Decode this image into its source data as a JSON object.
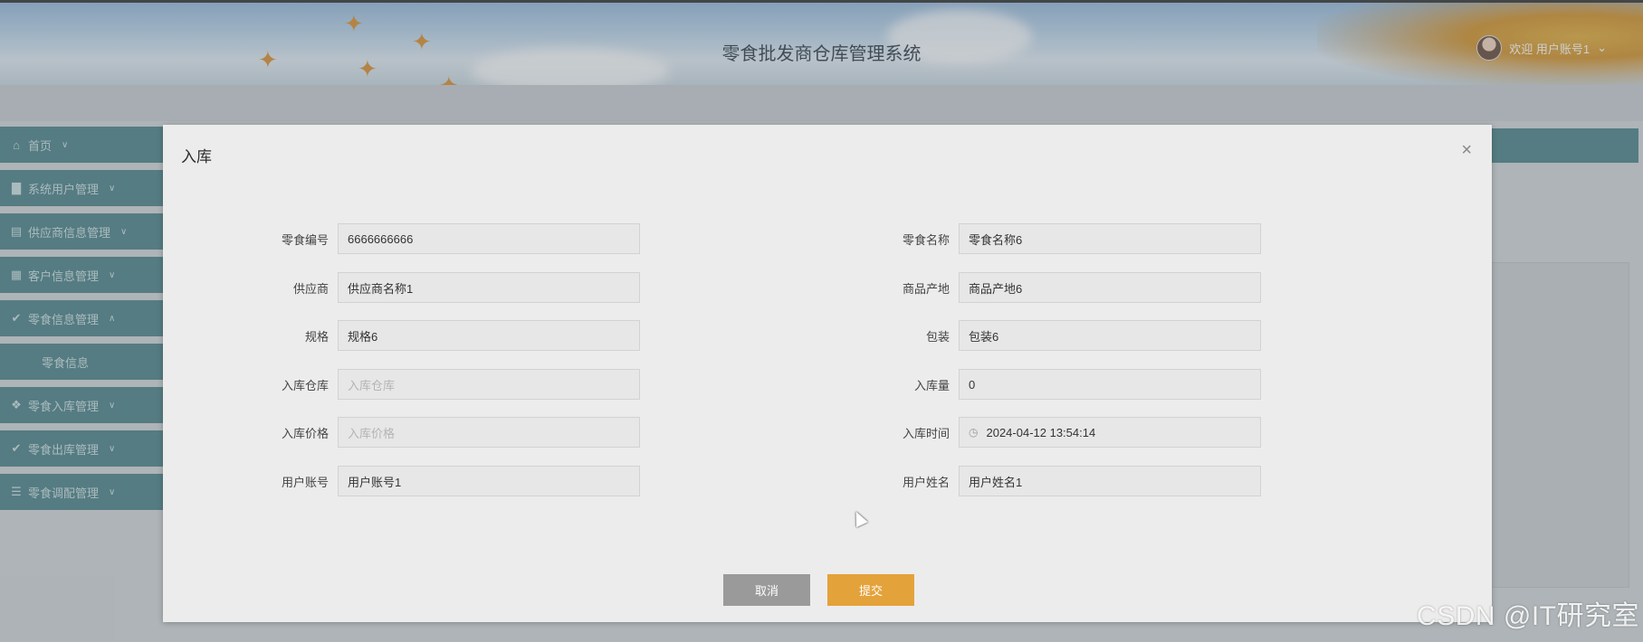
{
  "header": {
    "app_title": "零食批发商仓库管理系统",
    "user_greeting": "欢迎 用户账号1"
  },
  "sidebar": {
    "items": [
      {
        "label": "首页",
        "icon": "home-icon"
      },
      {
        "label": "系统用户管理",
        "icon": "user-icon"
      },
      {
        "label": "供应商信息管理",
        "icon": "folder-icon"
      },
      {
        "label": "客户信息管理",
        "icon": "grid-icon"
      },
      {
        "label": "零食信息管理",
        "icon": "check-circle-icon"
      },
      {
        "label": "零食入库管理",
        "icon": "apps-icon"
      },
      {
        "label": "零食出库管理",
        "icon": "check-circle-icon"
      },
      {
        "label": "零食调配管理",
        "icon": "list-icon"
      }
    ],
    "sub_item": "零食信息"
  },
  "dialog": {
    "title": "入库",
    "fields": {
      "snack_code": {
        "label": "零食编号",
        "value": "6666666666"
      },
      "snack_name": {
        "label": "零食名称",
        "value": "零食名称6"
      },
      "supplier": {
        "label": "供应商",
        "value": "供应商名称1"
      },
      "origin": {
        "label": "商品产地",
        "value": "商品产地6"
      },
      "spec": {
        "label": "规格",
        "value": "规格6"
      },
      "package": {
        "label": "包装",
        "value": "包装6"
      },
      "warehouse": {
        "label": "入库仓库",
        "placeholder": "入库仓库"
      },
      "quantity": {
        "label": "入库量",
        "value": "0"
      },
      "price": {
        "label": "入库价格",
        "placeholder": "入库价格"
      },
      "time": {
        "label": "入库时间",
        "value": "2024-04-12 13:54:14"
      },
      "account": {
        "label": "用户账号",
        "value": "用户账号1"
      },
      "user_name": {
        "label": "用户姓名",
        "value": "用户姓名1"
      }
    },
    "buttons": {
      "cancel": "取消",
      "submit": "提交"
    },
    "close": "×"
  },
  "watermark": "CSDN @IT研究室",
  "colors": {
    "sidebar": "#3f7a80",
    "submit": "#e4a23a",
    "cancel": "#9a9a9a"
  }
}
